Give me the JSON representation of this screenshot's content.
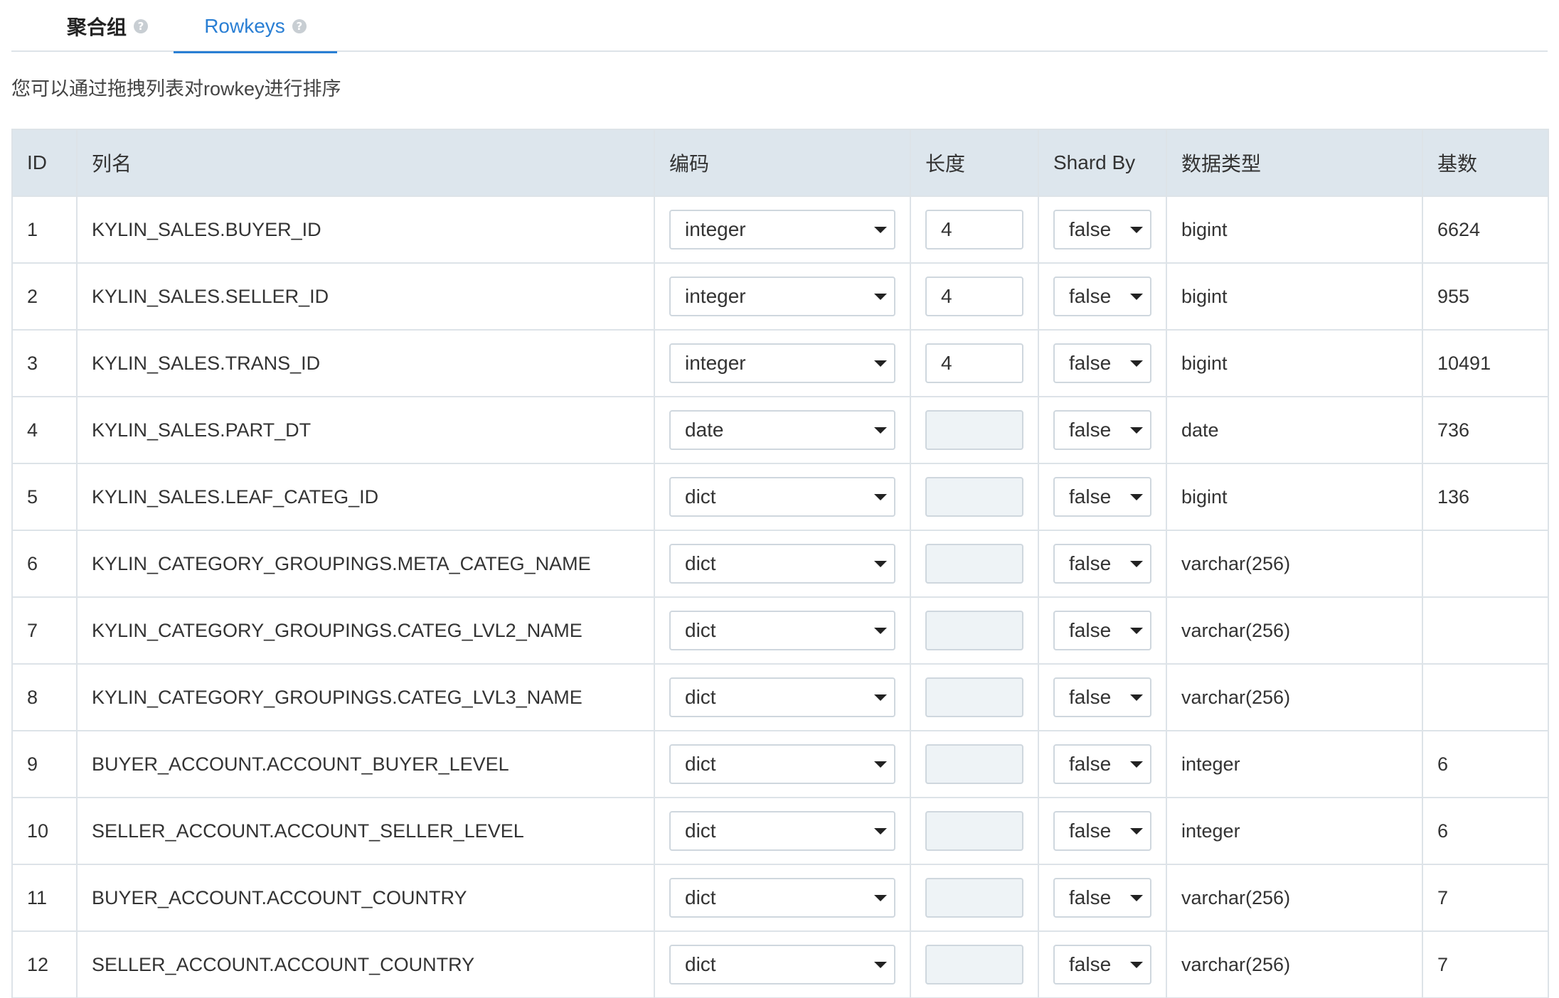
{
  "tabs": [
    {
      "label": "聚合组",
      "help": "?"
    },
    {
      "label": "Rowkeys",
      "help": "?"
    }
  ],
  "hint": "您可以通过拖拽列表对rowkey进行排序",
  "columns": {
    "id": "ID",
    "name": "列名",
    "encoding": "编码",
    "length": "长度",
    "shard_by": "Shard By",
    "data_type": "数据类型",
    "cardinality": "基数"
  },
  "rows": [
    {
      "id": "1",
      "name": "KYLIN_SALES.BUYER_ID",
      "encoding": "integer",
      "length": "4",
      "shard_by": "false",
      "data_type": "bigint",
      "cardinality": "6624"
    },
    {
      "id": "2",
      "name": "KYLIN_SALES.SELLER_ID",
      "encoding": "integer",
      "length": "4",
      "shard_by": "false",
      "data_type": "bigint",
      "cardinality": "955"
    },
    {
      "id": "3",
      "name": "KYLIN_SALES.TRANS_ID",
      "encoding": "integer",
      "length": "4",
      "shard_by": "false",
      "data_type": "bigint",
      "cardinality": "10491"
    },
    {
      "id": "4",
      "name": "KYLIN_SALES.PART_DT",
      "encoding": "date",
      "length": "",
      "shard_by": "false",
      "data_type": "date",
      "cardinality": "736"
    },
    {
      "id": "5",
      "name": "KYLIN_SALES.LEAF_CATEG_ID",
      "encoding": "dict",
      "length": "",
      "shard_by": "false",
      "data_type": "bigint",
      "cardinality": "136"
    },
    {
      "id": "6",
      "name": "KYLIN_CATEGORY_GROUPINGS.META_CATEG_NAME",
      "encoding": "dict",
      "length": "",
      "shard_by": "false",
      "data_type": "varchar(256)",
      "cardinality": ""
    },
    {
      "id": "7",
      "name": "KYLIN_CATEGORY_GROUPINGS.CATEG_LVL2_NAME",
      "encoding": "dict",
      "length": "",
      "shard_by": "false",
      "data_type": "varchar(256)",
      "cardinality": ""
    },
    {
      "id": "8",
      "name": "KYLIN_CATEGORY_GROUPINGS.CATEG_LVL3_NAME",
      "encoding": "dict",
      "length": "",
      "shard_by": "false",
      "data_type": "varchar(256)",
      "cardinality": ""
    },
    {
      "id": "9",
      "name": "BUYER_ACCOUNT.ACCOUNT_BUYER_LEVEL",
      "encoding": "dict",
      "length": "",
      "shard_by": "false",
      "data_type": "integer",
      "cardinality": "6"
    },
    {
      "id": "10",
      "name": "SELLER_ACCOUNT.ACCOUNT_SELLER_LEVEL",
      "encoding": "dict",
      "length": "",
      "shard_by": "false",
      "data_type": "integer",
      "cardinality": "6"
    },
    {
      "id": "11",
      "name": "BUYER_ACCOUNT.ACCOUNT_COUNTRY",
      "encoding": "dict",
      "length": "",
      "shard_by": "false",
      "data_type": "varchar(256)",
      "cardinality": "7"
    },
    {
      "id": "12",
      "name": "SELLER_ACCOUNT.ACCOUNT_COUNTRY",
      "encoding": "dict",
      "length": "",
      "shard_by": "false",
      "data_type": "varchar(256)",
      "cardinality": "7"
    }
  ],
  "colors": {
    "accent": "#2a7fd4",
    "header_bg": "#dde6ed",
    "border": "#dde3e8",
    "empty_input_bg": "#eef3f6"
  }
}
